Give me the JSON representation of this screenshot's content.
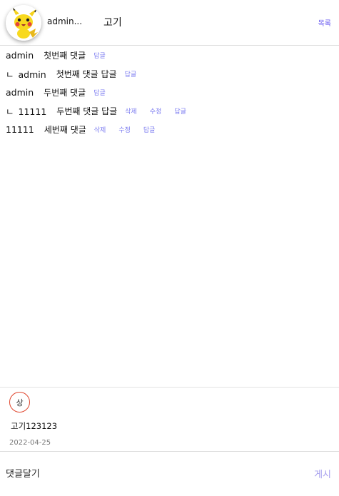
{
  "header": {
    "author": "admin...",
    "title": "고기",
    "list_label": "목록",
    "avatar_icon": "pikachu-avatar"
  },
  "comments": [
    {
      "reply": false,
      "author": "admin",
      "text": "첫번째 댓글",
      "actions": [
        "답글"
      ]
    },
    {
      "reply": true,
      "reply_mark": "ㄴ",
      "author": "admin",
      "text": "첫번째 댓글 답글",
      "actions": [
        "답글"
      ]
    },
    {
      "reply": false,
      "author": "admin",
      "text": "두번째 댓글",
      "actions": [
        "답글"
      ]
    },
    {
      "reply": true,
      "reply_mark": "ㄴ",
      "author": "11111",
      "text": "두번째 댓글 답글",
      "actions": [
        "삭제",
        "수정",
        "답글"
      ]
    },
    {
      "reply": false,
      "author": "11111",
      "text": "세번째 댓글",
      "actions": [
        "삭제",
        "수정",
        "답글"
      ]
    }
  ],
  "post": {
    "badge": "상",
    "content": "고기123123",
    "date": "2022-04-25"
  },
  "reply_bar": {
    "placeholder": "댓글달기",
    "submit_label": "게시"
  },
  "colors": {
    "accent": "#6b5cf0",
    "action": "#7b7bf0",
    "badge_border": "#e0472f"
  }
}
